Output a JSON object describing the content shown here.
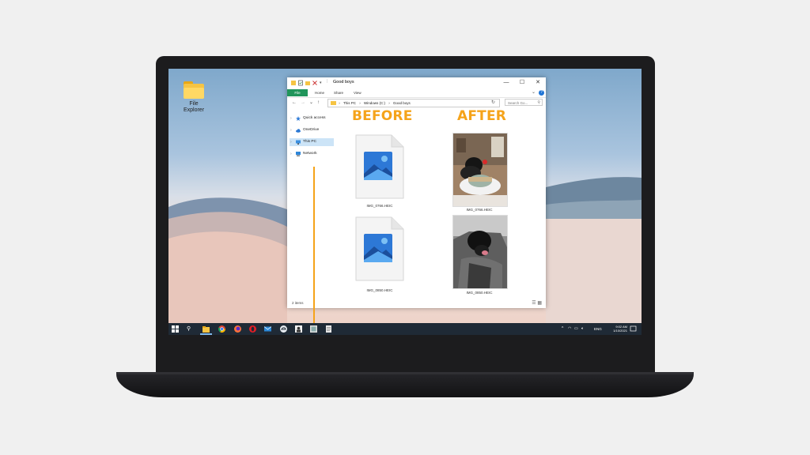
{
  "desktop": {
    "icon_label": "File Explorer"
  },
  "window": {
    "title": "Good boys",
    "controls": {
      "minimize": "—",
      "maximize": "☐",
      "close": "✕"
    }
  },
  "ribbon": {
    "file_tab": "File",
    "tabs": [
      "Home",
      "Share",
      "View"
    ],
    "help": "?"
  },
  "address_bar": {
    "back": "←",
    "forward": "→",
    "recent": "⌄",
    "up": "↑",
    "crumbs": [
      "This PC",
      "Windows (C:)",
      "Good boys"
    ],
    "separator": "›",
    "search_placeholder": "Search Go..."
  },
  "nav_pane": {
    "items": [
      {
        "label": "Quick access",
        "icon": "star-icon"
      },
      {
        "label": "OneDrive",
        "icon": "cloud-icon"
      },
      {
        "label": "This PC",
        "icon": "computer-icon",
        "selected": true
      },
      {
        "label": "Network",
        "icon": "network-icon"
      }
    ]
  },
  "content": {
    "before_heading": "BEFORE",
    "after_heading": "AFTER",
    "before_files": [
      "IMG_0766.HEIC",
      "IMG_0850.HEIC"
    ],
    "after_files": [
      "IMG_0766.HEIC",
      "IMG_0850.HEIC"
    ]
  },
  "status_bar": {
    "item_count": "2 items"
  },
  "taskbar": {
    "language": "ENG",
    "time": "9:02 AM",
    "date": "1/10/2021"
  },
  "colors": {
    "accent": "#f5a31a",
    "file_tab": "#21955b",
    "taskbar": "#1f2a36",
    "selection": "#cce4f7"
  }
}
